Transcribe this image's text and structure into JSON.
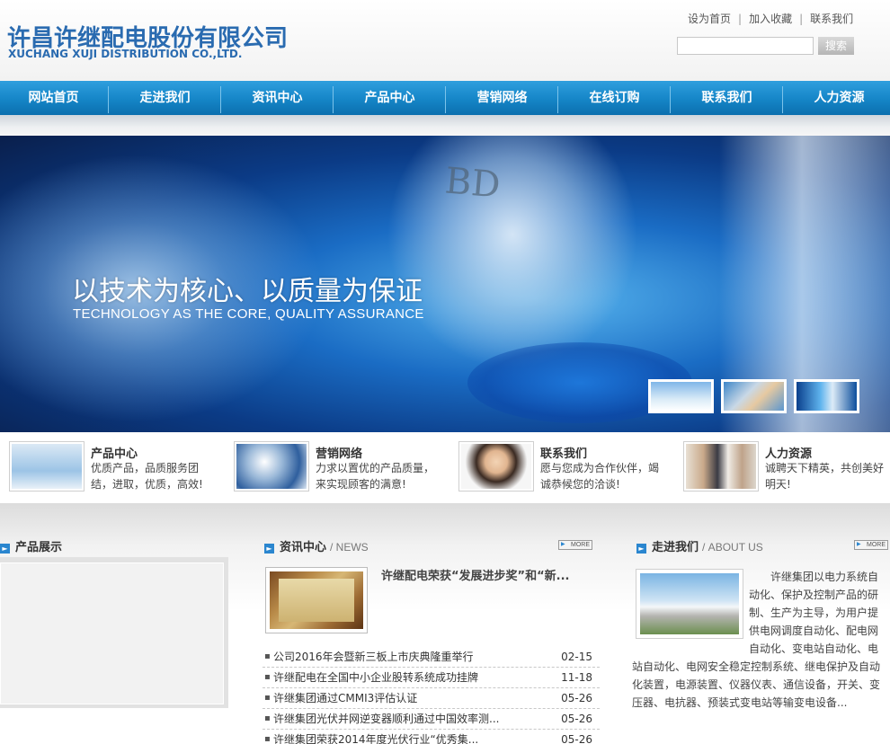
{
  "header": {
    "logo_cn": "许昌许继配电股份有限公司",
    "logo_en": "XUCHANG XUJI DISTRIBUTION CO.,LTD.",
    "top_links": [
      "设为首页",
      "加入收藏",
      "联系我们"
    ],
    "search_button": "搜索"
  },
  "nav": {
    "items": [
      "网站首页",
      "走进我们",
      "资讯中心",
      "产品中心",
      "营销网络",
      "在线订购",
      "联系我们",
      "人力资源"
    ]
  },
  "banner": {
    "title_cn": "以技术为核心、以质量为保证",
    "title_en": "TECHNOLOGY AS THE CORE, QUALITY ASSURANCE",
    "bd_text": "BD"
  },
  "features": [
    {
      "title": "产品中心",
      "desc": "优质产品，品质服务团结，进取，优质，高效!"
    },
    {
      "title": "营销网络",
      "desc": "力求以置优的产品质量，来实现顾客的满意!"
    },
    {
      "title": "联系我们",
      "desc": "愿与您成为合作伙伴，竭诚恭候您的洽谈!"
    },
    {
      "title": "人力资源",
      "desc": "诚聘天下精英，共创美好明天!"
    }
  ],
  "products": {
    "title": "产品展示"
  },
  "news": {
    "title": "资讯中心",
    "subtitle": "/ NEWS",
    "more": "MORE",
    "headline": "许继配电荣获“发展进步奖”和“新...",
    "items": [
      {
        "title": "公司2016年会暨新三板上市庆典隆重举行",
        "date": "02-15"
      },
      {
        "title": "许继配电在全国中小企业股转系统成功挂牌",
        "date": "11-18"
      },
      {
        "title": "许继集团通过CMMI3评估认证",
        "date": "05-26"
      },
      {
        "title": "许继集团光伏并网逆变器顺利通过中国效率测...",
        "date": "05-26"
      },
      {
        "title": "许继集团荣获2014年度光伏行业“优秀集...",
        "date": "05-26"
      }
    ]
  },
  "about": {
    "title": "走进我们",
    "subtitle": "/ ABOUT US",
    "more": "MORE",
    "text": "许继集团以电力系统自动化、保护及控制产品的研制、生产为主导，为用户提供电网调度自动化、配电网自动化、变电站自动化、电站自动化、电网安全稳定控制系统、继电保护及自动化装置，电源装置、仪器仪表、通信设备，开关、变压器、电抗器、预装式变电站等输变电设备..."
  }
}
